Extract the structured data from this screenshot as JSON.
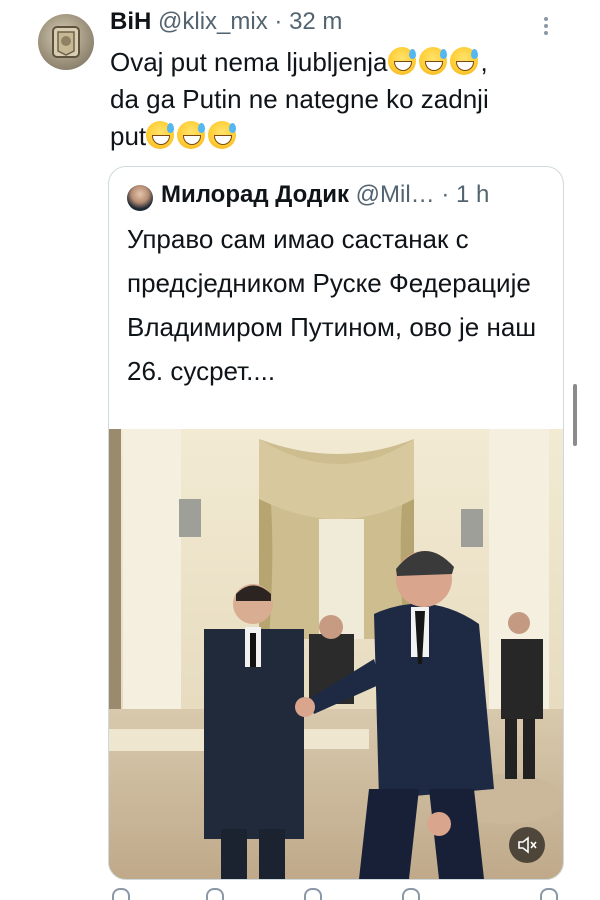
{
  "tweet": {
    "display_name": "BiH",
    "handle": "@klix_mix",
    "separator": "·",
    "time": "32 m",
    "text_line1": "Ovaj put nema ljubljenja",
    "text_line1_end": ",",
    "text_line2": "da ga Putin ne nategne ko zadnji",
    "text_line3": "put",
    "emoji": "sweat-smile-emoji"
  },
  "quote": {
    "display_name": "Милорад Додик",
    "handle": "@Mil…",
    "separator": "·",
    "time": "1 h",
    "text": "Управо сам имао састанак с предсједником Руске Федерације Владимиром Путином, ово је наш 26. сусрет....",
    "media_icon": "speaker-mute-icon"
  },
  "icons": {
    "more": "more-vertical-icon",
    "reply": "reply-icon",
    "retweet": "retweet-icon",
    "like": "heart-icon",
    "views": "views-icon",
    "share": "share-icon"
  },
  "colors": {
    "name": "#0f1419",
    "secondary": "#536471",
    "border": "#cfd9de"
  }
}
